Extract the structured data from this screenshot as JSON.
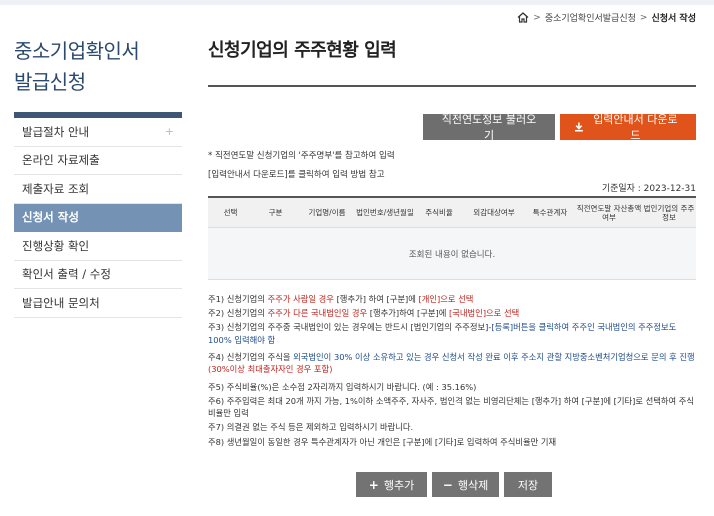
{
  "breadcrumb": {
    "items": [
      "중소기업확인서발급신청",
      "신청서 작성"
    ]
  },
  "sidebar": {
    "title_line1": "중소기업확인서",
    "title_line2": "발급신청",
    "items": [
      {
        "label": "발급절차 안내",
        "plus": "+"
      },
      {
        "label": "온라인 자료제출"
      },
      {
        "label": "제출자료 조회"
      },
      {
        "label": "신청서 작성",
        "active": true
      },
      {
        "label": "진행상황 확인"
      },
      {
        "label": "확인서 출력 / 수정"
      },
      {
        "label": "발급안내 문의처"
      }
    ]
  },
  "main": {
    "title": "신청기업의 주주현황 입력",
    "prev_year_button": "직전연도정보 불러오기",
    "guide_download_button": "입력안내서 다운로드",
    "note1": "* 직전연도말 신청기업의 '주주명부'를 참고하여 입력",
    "note2": "[입력안내서 다운로드]를 클릭하여 입력 방법 참고",
    "base_date": "기준일자 : 2023-12-31",
    "table": {
      "headers": [
        "선택",
        "구분",
        "기업명/이름",
        "법인번호/생년월일",
        "주식비율",
        "외감대상여부",
        "특수관계자",
        "직전연도말 자산총액 여부",
        "법인기업의 주주정보"
      ],
      "empty": "조회된 내용이 없습니다."
    },
    "notes": {
      "n1_a": "주1) 신청기업의 ",
      "n1_b": "주주가 사람일 경우",
      "n1_c": " [행추가] 하여 [구분]에 ",
      "n1_d": "[개인]으로 선택",
      "n2_a": "주2) 신청기업의 ",
      "n2_b": "주주가 다른 국내법인일 경우",
      "n2_c": " [행추가]하여 [구분]에 ",
      "n2_d": "[국내법인]으로 선택",
      "n3_a": "주3) 신청기업의 주주중 국내법인이 있는 경우에는 반드시 [법인기업의 주주정보]-",
      "n3_b": "[등록]버튼을 클릭하여 주주인 국내법인의 주주정보도 100% 입력해야 함",
      "n4_a": "주4) 신청기업의 주식을 ",
      "n4_b": "외국법인이 30% 이상 소유하고 있는 경우 신청서 작성 완료 이후 주소지 관할 지방중소벤처기업청으로 문의 후 진행",
      "n4_c": "(30%이상 최대출자자인 경우 포함)",
      "n5": "주5) 주식비율(%)은 소수점 2자리까지 입력하시기 바랍니다. (예 : 35.16%)",
      "n6": "주6) 주주입력은 최대 20개 까지 가능, 1%이하 소액주주, 자사주, 법인격 없는 비영리단체는 [행추가] 하여 [구분]에 [기타]로 선택하여 주식비율만 입력",
      "n7": "주7) 의결권 없는 주식 등은 제외하고 입력하시기 바랍니다.",
      "n8": "주8) 생년월일이 동일한 경우 특수관계자가 아닌 개인은 [구분]에 [기타]로 입력하여 주식비율만 기재"
    },
    "add_row": "행추가",
    "delete_row": "행삭제",
    "save": "저장"
  },
  "colors": {
    "accent_orange": "#e0541c",
    "sidebar_active": "#7392b4",
    "sidebar_title": "#2c4a6e",
    "warning_red": "#c0231d",
    "info_blue": "#1d4b8a"
  }
}
